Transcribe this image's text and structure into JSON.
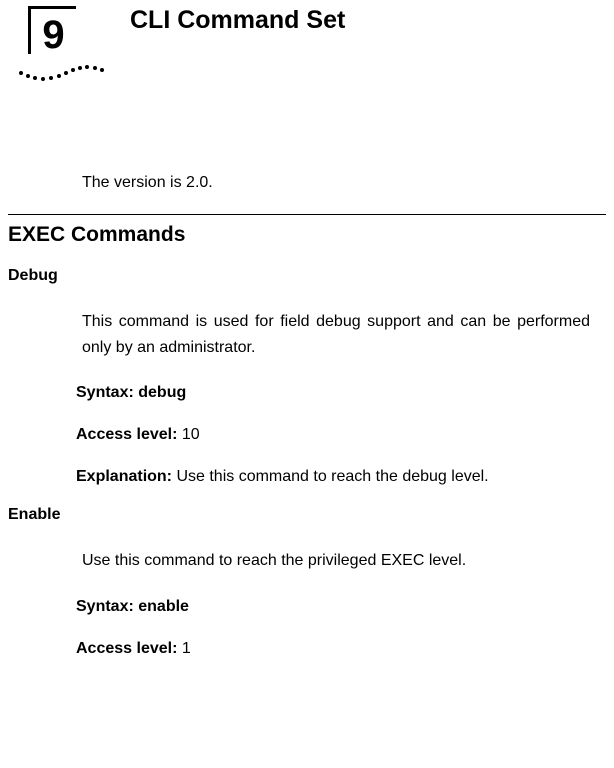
{
  "chapter": {
    "number": "9",
    "title": "CLI Command Set"
  },
  "version_text": "The version is 2.0.",
  "section_heading": "EXEC Commands",
  "commands": [
    {
      "name": "Debug",
      "description": "This command is used for field debug support and can be performed only by an administrator.",
      "syntax_label": "Syntax: ",
      "syntax_value": "debug",
      "access_label": "Access level: ",
      "access_value": "10",
      "explanation_label": "Explanation: ",
      "explanation_value": "Use this command to reach the debug level."
    },
    {
      "name": "Enable",
      "description": "Use this command to reach the privileged EXEC level.",
      "syntax_label": "Syntax: ",
      "syntax_value": "enable",
      "access_label": "Access level: ",
      "access_value": "1"
    }
  ]
}
